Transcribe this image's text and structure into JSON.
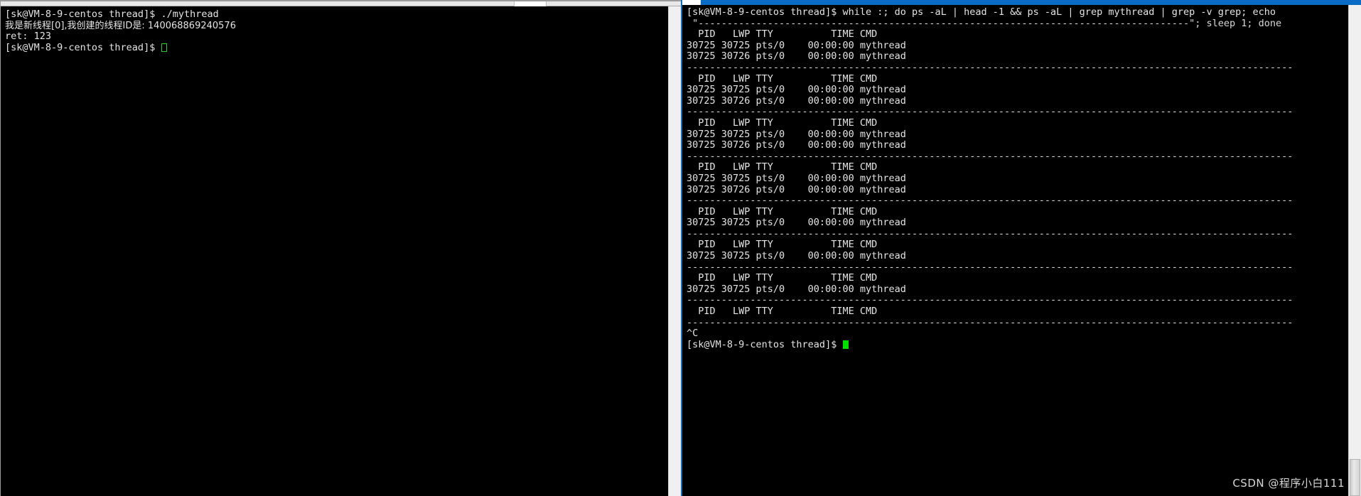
{
  "left_terminal": {
    "name": "left-terminal",
    "lines": [
      {
        "type": "prompt",
        "text": "[sk@VM-8-9-centos thread]$ ./mythread"
      },
      {
        "type": "cn",
        "text": "我是新线程[0],我创建的线程ID是: 140068869240576"
      },
      {
        "type": "out",
        "text": "ret: 123"
      },
      {
        "type": "prompt_cursor",
        "text": "[sk@VM-8-9-centos thread]$ ",
        "cursor": "hollow"
      }
    ]
  },
  "right_terminal": {
    "name": "right-terminal",
    "command_line": "[sk@VM-8-9-centos thread]$ while :; do ps -aL | head -1 && ps -aL | grep mythread | grep -v grep; echo",
    "command_line_2": " \"-------------------------------------------------------------------------------------\"; sleep 1; done",
    "separator": "---------------------------------------------------------------------------------------------------------",
    "header": "  PID   LWP TTY          TIME CMD",
    "blocks": [
      {
        "rows": [
          "30725 30725 pts/0    00:00:00 mythread",
          "30725 30726 pts/0    00:00:00 mythread"
        ]
      },
      {
        "rows": [
          "30725 30725 pts/0    00:00:00 mythread",
          "30725 30726 pts/0    00:00:00 mythread"
        ]
      },
      {
        "rows": [
          "30725 30725 pts/0    00:00:00 mythread",
          "30725 30726 pts/0    00:00:00 mythread"
        ]
      },
      {
        "rows": [
          "30725 30725 pts/0    00:00:00 mythread",
          "30725 30726 pts/0    00:00:00 mythread"
        ]
      },
      {
        "rows": [
          "30725 30725 pts/0    00:00:00 mythread"
        ]
      },
      {
        "rows": [
          "30725 30725 pts/0    00:00:00 mythread"
        ]
      },
      {
        "rows": [
          "30725 30725 pts/0    00:00:00 mythread"
        ]
      },
      {
        "rows": []
      }
    ],
    "interrupt": "^C",
    "final_prompt": "[sk@VM-8-9-centos thread]$ ",
    "final_cursor": "solid"
  },
  "watermark": {
    "text": "CSDN @程序小白111"
  },
  "colors": {
    "terminal_bg": "#000000",
    "terminal_fg": "#e4e4e4",
    "titlebar_active": "#0a6cc4",
    "cursor_green": "#00e000",
    "scrollbar_bg": "#f0f0f0"
  }
}
